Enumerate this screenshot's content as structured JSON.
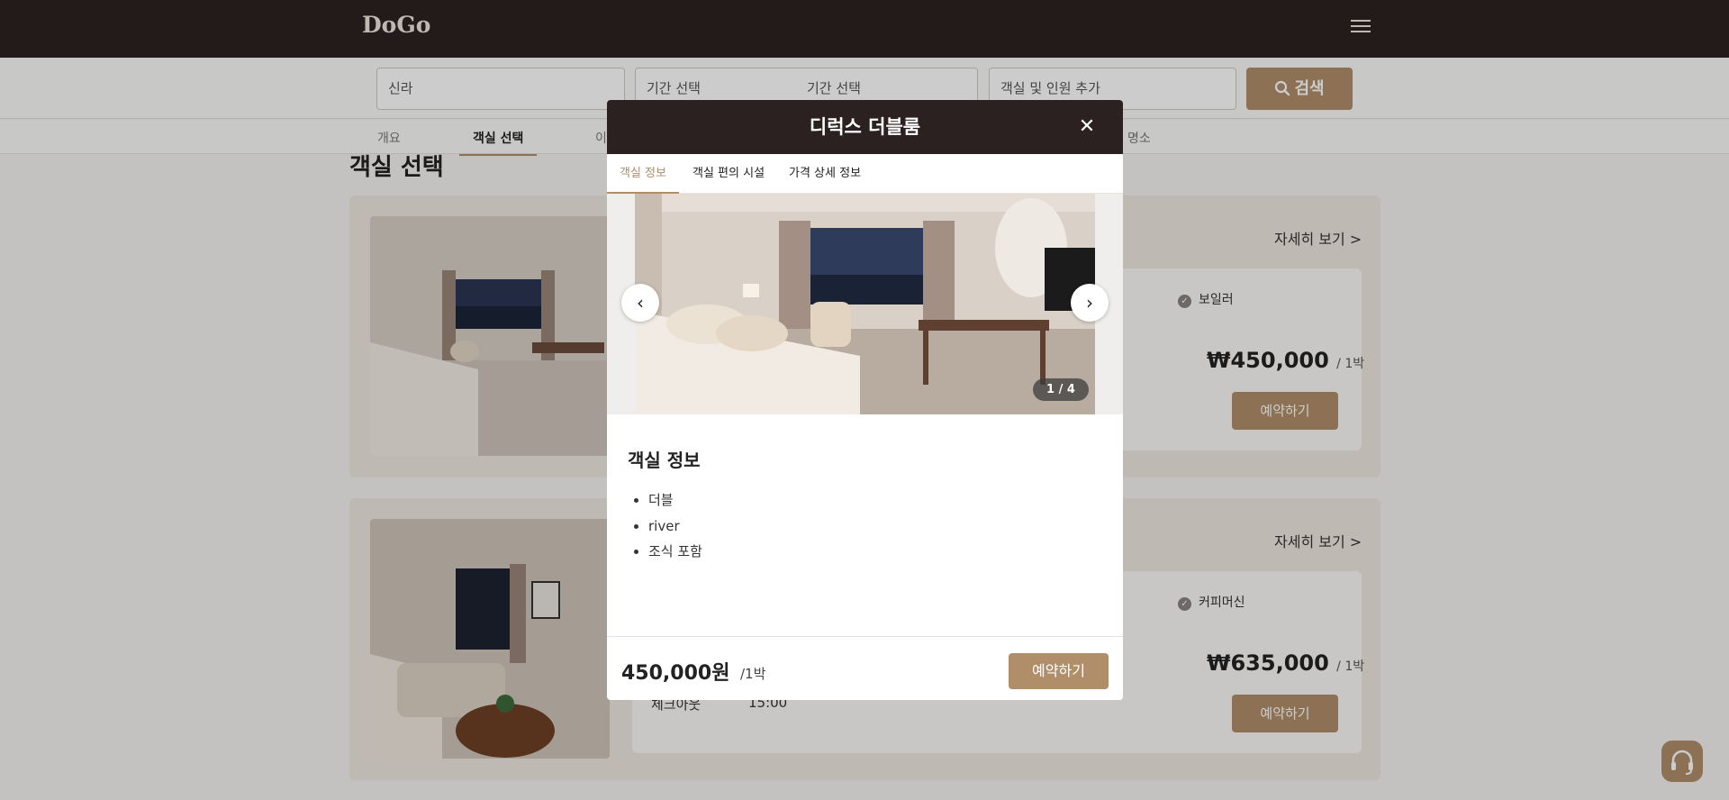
{
  "header": {
    "logo": "DoGo"
  },
  "search": {
    "location_value": "신라",
    "checkin_placeholder": "기간 선택",
    "checkout_placeholder": "기간 선택",
    "guests_placeholder": "객실 및 인원 추가",
    "button_label": "검색"
  },
  "nav_tabs": [
    {
      "label": "개요"
    },
    {
      "label": "객실 선택"
    },
    {
      "label": "이"
    },
    {
      "label": "명소"
    }
  ],
  "section_title": "객실 선택",
  "rooms": [
    {
      "more_link": "자세히 보기 >",
      "amenity": "보일러",
      "price": "₩450,000",
      "per_night": "/ 1박",
      "reserve_label": "예약하기"
    },
    {
      "more_link": "자세히 보기 >",
      "amenity": "커피머신",
      "price": "₩635,000",
      "per_night": "/ 1박",
      "reserve_label": "예약하기",
      "partial_label": "체크아웃",
      "partial_value": "15:00"
    }
  ],
  "modal": {
    "title": "디럭스 더블룸",
    "close_glyph": "✕",
    "tabs": [
      {
        "label": "객실 정보"
      },
      {
        "label": "객실 편의 시설"
      },
      {
        "label": "가격 상세 정보"
      }
    ],
    "gallery": {
      "counter": "1 / 4",
      "prev_glyph": "‹",
      "next_glyph": "›"
    },
    "info_title": "객실 정보",
    "info_items": [
      "더블",
      "river",
      "조식 포함"
    ],
    "price": "450,000원",
    "per_night": "/1박",
    "reserve_label": "예약하기"
  },
  "icons": {
    "menu": "hamburger-icon",
    "search": "search-icon",
    "check": "check-circle-icon",
    "chat": "headset-icon"
  },
  "colors": {
    "brand_dark": "#2c2121",
    "accent": "#b08e6a"
  }
}
